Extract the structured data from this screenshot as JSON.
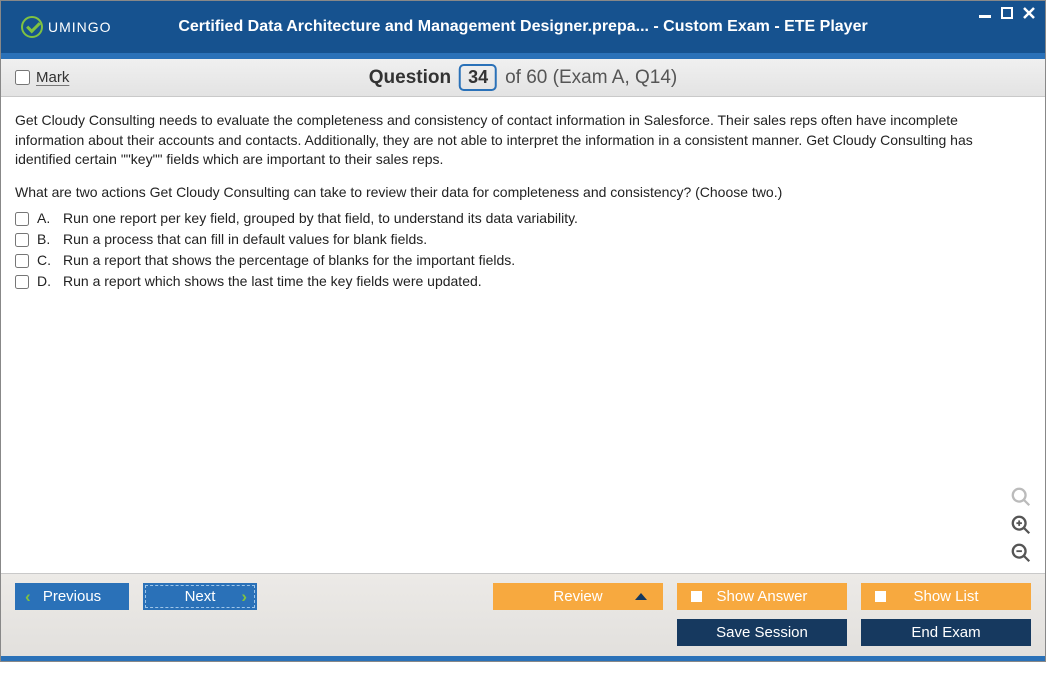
{
  "window": {
    "logo_text": "UMINGO",
    "title": "Certified Data Architecture and Management Designer.prepa... - Custom Exam - ETE Player"
  },
  "info_bar": {
    "mark_label": "Mark",
    "question_label": "Question",
    "current_number": "34",
    "total_label": "of 60 (Exam A, Q14)"
  },
  "question": {
    "text": "Get Cloudy Consulting needs to evaluate the completeness and consistency of contact information in Salesforce. Their sales reps often have incomplete information about their accounts and contacts. Additionally, they are not able to interpret the information in a consistent manner. Get Cloudy Consulting has identified certain \"\"key\"\" fields which are important to their sales reps.",
    "prompt": "What are two actions Get Cloudy Consulting can take to review their data for completeness and consistency? (Choose two.)",
    "answers": [
      {
        "letter": "A.",
        "text": "Run one report per key field, grouped by that field, to understand its data variability."
      },
      {
        "letter": "B.",
        "text": "Run a process that can fill in default values for blank fields."
      },
      {
        "letter": "C.",
        "text": "Run a report that shows the percentage of blanks for the important fields."
      },
      {
        "letter": "D.",
        "text": "Run a report which shows the last time the key fields were updated."
      }
    ]
  },
  "footer": {
    "previous": "Previous",
    "next": "Next",
    "review": "Review",
    "show_answer": "Show Answer",
    "show_list": "Show List",
    "save_session": "Save Session",
    "end_exam": "End Exam"
  }
}
